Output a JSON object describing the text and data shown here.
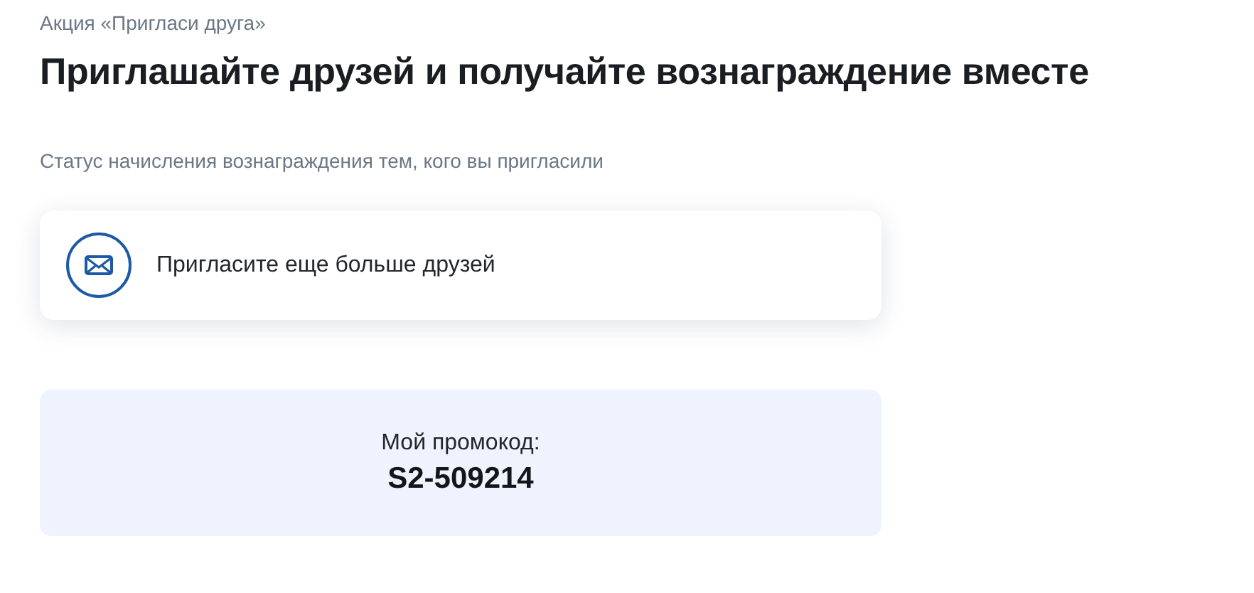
{
  "breadcrumb": "Акция «Пригласи друга»",
  "title": "Приглашайте друзей и получайте вознаграждение вместе",
  "subtitle": "Статус начисления вознаграждения тем, кого вы пригласили",
  "invite_card": {
    "text": "Пригласите еще больше друзей"
  },
  "promo": {
    "label": "Мой промокод:",
    "code": "S2-509214"
  }
}
